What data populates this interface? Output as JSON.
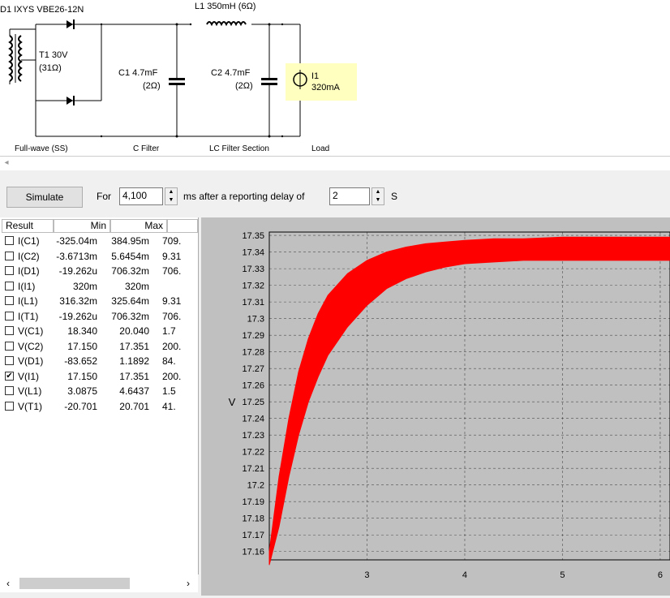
{
  "schematic": {
    "transformer_label": "D1 IXYS  VBE26-12N",
    "t1_label": "T1 30V",
    "t1_res": "(31Ω)",
    "l1_label": "L1 350mH (6Ω)",
    "c1_label": "C1 4.7mF",
    "c1_res": "(2Ω)",
    "c2_label": "C2 4.7mF",
    "c2_res": "(2Ω)",
    "i1_label": "I1",
    "i1_value": "320mA",
    "sections": [
      "Full-wave (SS)",
      "C Filter",
      "LC Filter Section",
      "Load"
    ]
  },
  "controls": {
    "simulate_label": "Simulate",
    "for_label": "For",
    "duration_value": "4,100",
    "ms_label": "ms  after a reporting delay of",
    "delay_value": "2",
    "s_label": "S"
  },
  "results": {
    "headers": [
      "Result",
      "Min",
      "Max"
    ],
    "rows": [
      {
        "name": "I(C1)",
        "min": "-325.04m",
        "max": "384.95m",
        "extra": "709.",
        "checked": false
      },
      {
        "name": "I(C2)",
        "min": "-3.6713m",
        "max": "5.6454m",
        "extra": "9.31",
        "checked": false
      },
      {
        "name": "I(D1)",
        "min": "-19.262u",
        "max": "706.32m",
        "extra": "706.",
        "checked": false
      },
      {
        "name": "I(I1)",
        "min": "320m",
        "max": "320m",
        "extra": "",
        "checked": false
      },
      {
        "name": "I(L1)",
        "min": "316.32m",
        "max": "325.64m",
        "extra": "9.31",
        "checked": false
      },
      {
        "name": "I(T1)",
        "min": "-19.262u",
        "max": "706.32m",
        "extra": "706.",
        "checked": false
      },
      {
        "name": "V(C1)",
        "min": "18.340",
        "max": "20.040",
        "extra": "1.7",
        "checked": false
      },
      {
        "name": "V(C2)",
        "min": "17.150",
        "max": "17.351",
        "extra": "200.",
        "checked": false
      },
      {
        "name": "V(D1)",
        "min": "-83.652",
        "max": "1.1892",
        "extra": "84.",
        "checked": false
      },
      {
        "name": "V(I1)",
        "min": "17.150",
        "max": "17.351",
        "extra": "200.",
        "checked": true
      },
      {
        "name": "V(L1)",
        "min": "3.0875",
        "max": "4.6437",
        "extra": "1.5",
        "checked": false
      },
      {
        "name": "V(T1)",
        "min": "-20.701",
        "max": "20.701",
        "extra": "41.",
        "checked": false
      }
    ]
  },
  "chart_data": {
    "type": "area",
    "ylabel": "V",
    "xlim": [
      2,
      6.1
    ],
    "ylim": [
      17.155,
      17.352
    ],
    "yticks": [
      "17.35",
      "17.34",
      "17.33",
      "17.32",
      "17.31",
      "17.3",
      "17.29",
      "17.28",
      "17.27",
      "17.26",
      "17.25",
      "17.24",
      "17.23",
      "17.22",
      "17.21",
      "17.2",
      "17.19",
      "17.18",
      "17.17",
      "17.16"
    ],
    "xticks": [
      "3",
      "4",
      "5",
      "6"
    ],
    "grid": true,
    "series": [
      {
        "color": "#ff0000",
        "x": [
          2.0,
          2.1,
          2.2,
          2.3,
          2.4,
          2.5,
          2.6,
          2.8,
          3.0,
          3.2,
          3.4,
          3.6,
          3.8,
          4.0,
          4.3,
          4.6,
          5.0,
          5.5,
          6.0,
          6.1
        ],
        "upper": [
          17.16,
          17.205,
          17.24,
          17.268,
          17.288,
          17.303,
          17.314,
          17.327,
          17.335,
          17.34,
          17.343,
          17.345,
          17.346,
          17.347,
          17.348,
          17.348,
          17.349,
          17.349,
          17.349,
          17.349
        ],
        "lower": [
          17.152,
          17.175,
          17.205,
          17.23,
          17.25,
          17.265,
          17.278,
          17.295,
          17.308,
          17.318,
          17.324,
          17.328,
          17.331,
          17.333,
          17.334,
          17.335,
          17.335,
          17.335,
          17.335,
          17.335
        ]
      }
    ]
  }
}
